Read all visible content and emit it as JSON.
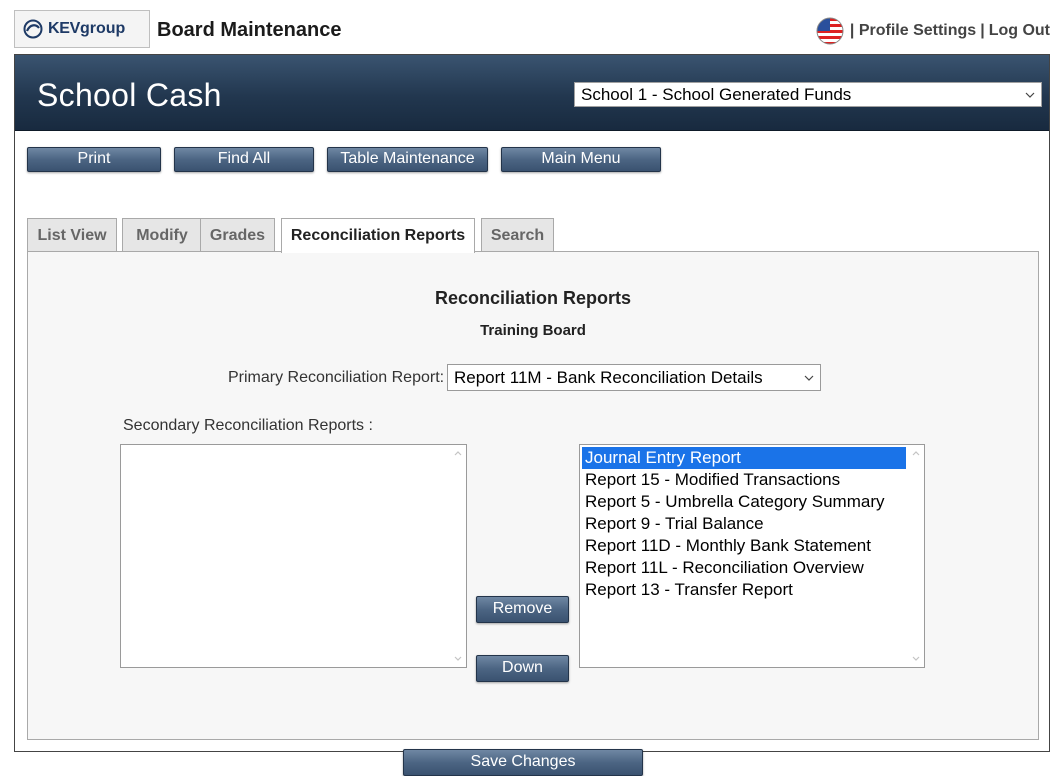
{
  "header": {
    "logo_kev": "KEV",
    "logo_group": "group",
    "app_title": "Board Maintenance",
    "profile_settings": "| Profile Settings",
    "separator": "|",
    "log_out": "Log Out",
    "flag_icon": "us-flag-icon"
  },
  "banner": {
    "title": "School Cash",
    "school_selected": "School 1 - School Generated Funds"
  },
  "toolbar": {
    "print": "Print",
    "find_all": "Find All",
    "table_maintenance": "Table Maintenance",
    "main_menu": "Main Menu"
  },
  "tabs": [
    {
      "label": "List View",
      "active": false
    },
    {
      "label": "Modify",
      "active": false
    },
    {
      "label": "Grades",
      "active": false
    },
    {
      "label": "Reconciliation Reports",
      "active": true
    },
    {
      "label": "Search",
      "active": false
    }
  ],
  "panel": {
    "title": "Reconciliation Reports",
    "subtitle": "Training Board",
    "primary_label": "Primary Reconciliation Report:",
    "primary_selected": "Report 11M - Bank Reconciliation Details",
    "secondary_label": "Secondary Reconciliation Reports :",
    "left_list": [],
    "right_list": [
      "Journal Entry Report",
      "Report 15 - Modified Transactions",
      "Report 5 - Umbrella Category Summary",
      "Report 9 - Trial Balance",
      "Report 11D - Monthly Bank Statement",
      "Report 11L - Reconciliation Overview",
      "Report 13 - Transfer Report"
    ],
    "right_selected_index": 0,
    "remove_label": "Remove",
    "down_label": "Down",
    "save_label": "Save Changes"
  },
  "colors": {
    "banner": "#22374f",
    "button": "#4c6583",
    "selection": "#1a73e8"
  }
}
